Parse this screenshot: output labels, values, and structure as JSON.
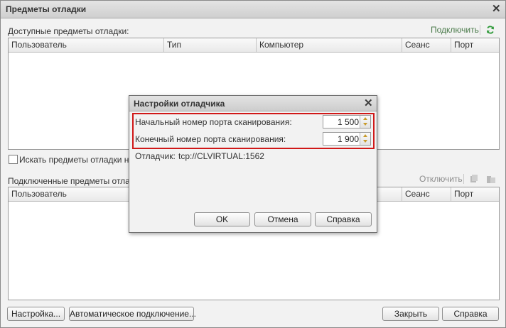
{
  "window": {
    "title": "Предметы отладки",
    "available_label": "Доступные предметы отладки:",
    "connect_link": "Подключить",
    "available_columns": [
      "Пользователь",
      "Тип",
      "Компьютер",
      "Сеанс",
      "Порт"
    ],
    "search_checkbox_label": "Искать предметы отладки на у",
    "connected_label": "Подключенные предметы отладк",
    "disconnect_link": "Отключить",
    "connected_columns": [
      "Пользователь",
      "Сеанс",
      "Порт"
    ],
    "buttons": {
      "settings": "Настройка...",
      "auto_connect": "Автоматическое подключение...",
      "close": "Закрыть",
      "help": "Справка"
    }
  },
  "dialog": {
    "title": "Настройки отладчика",
    "start_port_label": "Начальный номер порта сканирования:",
    "start_port_value": "1 500",
    "end_port_label": "Конечный номер порта сканирования:",
    "end_port_value": "1 900",
    "debugger_label": "Отладчик:",
    "debugger_value": "tcp://CLVIRTUAL:1562",
    "buttons": {
      "ok": "OK",
      "cancel": "Отмена",
      "help": "Справка"
    }
  },
  "colors": {
    "highlight": "#d01818",
    "link": "#4a7a4a",
    "refresh_icon": "#2f9a3a",
    "spin_arrow": "#c89a2a"
  }
}
